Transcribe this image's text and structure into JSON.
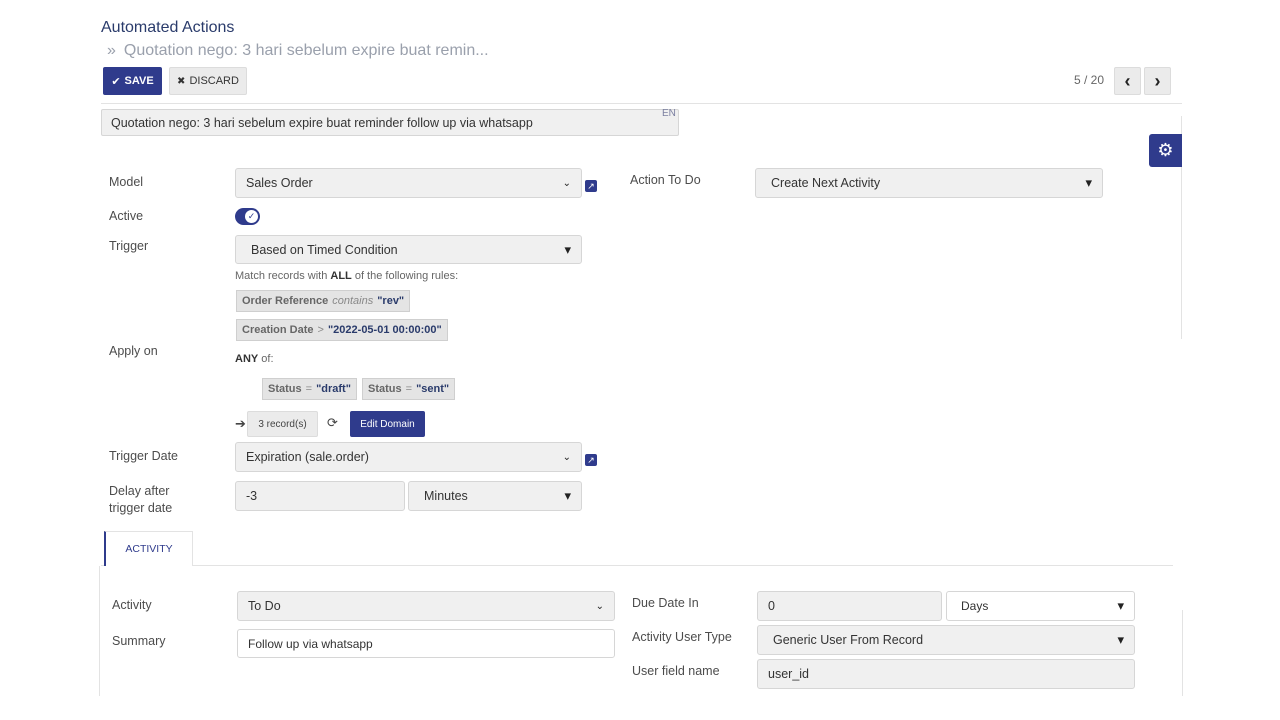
{
  "header": {
    "app_title": "Automated Actions",
    "breadcrumb_sep": "»",
    "breadcrumb": "Quotation nego: 3 hari sebelum expire buat remin..."
  },
  "toolbar": {
    "save_icon": "✔",
    "save_label": "SAVE",
    "discard_icon": "✖",
    "discard_label": "DISCARD"
  },
  "pager": {
    "text": "5 / 20",
    "prev": "‹",
    "next": "›"
  },
  "record": {
    "name": "Quotation nego: 3 hari sebelum expire buat reminder follow up via whatsapp",
    "lang": "EN"
  },
  "form": {
    "model_label": "Model",
    "model_value": "Sales Order",
    "active_label": "Active",
    "active_on": true,
    "trigger_label": "Trigger",
    "trigger_value": "Based on Timed Condition",
    "apply_on_label": "Apply on",
    "action_label": "Action To Do",
    "action_value": "Create Next Activity",
    "trigger_date_label": "Trigger Date",
    "trigger_date_value": "Expiration (sale.order)",
    "delay_label_1": "Delay after",
    "delay_label_2": "trigger date",
    "delay_value": "-3",
    "delay_unit": "Minutes"
  },
  "domain": {
    "match_prefix": "Match records with ",
    "match_bold": "ALL",
    "match_suffix": " of the following rules:",
    "rule1": {
      "field": "Order Reference",
      "op": "contains",
      "value": "\"rev\""
    },
    "rule2": {
      "field": "Creation Date",
      "op": ">",
      "value": "\"2022-05-01 00:00:00\""
    },
    "any_bold": "ANY",
    "any_suffix": " of:",
    "rule3": {
      "field": "Status",
      "op": "=",
      "value": "\"draft\""
    },
    "rule4": {
      "field": "Status",
      "op": "=",
      "value": "\"sent\""
    },
    "record_count": "3 record(s)",
    "edit_label": "Edit Domain"
  },
  "tabs": {
    "activity": "ACTIVITY"
  },
  "activity": {
    "activity_label": "Activity",
    "activity_value": "To Do",
    "summary_label": "Summary",
    "summary_value": "Follow up via whatsapp",
    "due_label": "Due Date In",
    "due_value": "0",
    "due_unit": "Days",
    "user_type_label": "Activity User Type",
    "user_type_value": "Generic User From Record",
    "user_field_label": "User field name",
    "user_field_value": "user_id"
  },
  "icons": {
    "chevron": "⌄",
    "select_arrow": "▾",
    "external": "↗",
    "arrow_right": "➔",
    "refresh": "⟳",
    "gear": "⚙",
    "check": "✓"
  },
  "colors": {
    "accent": "#2f3b8c",
    "title": "#2a3b6b"
  }
}
